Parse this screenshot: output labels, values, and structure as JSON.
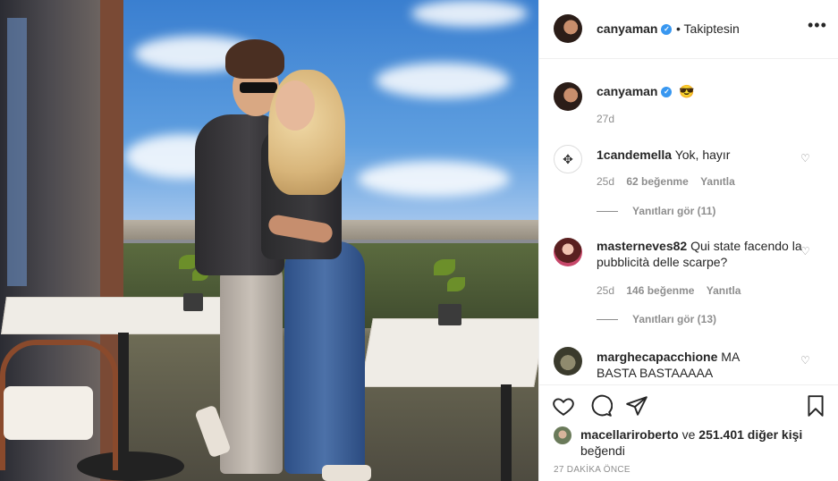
{
  "header": {
    "username": "canyaman",
    "follow_status": "• Takiptesin",
    "more_icon": "more-options-icon"
  },
  "caption": {
    "username": "canyaman",
    "emoji": "😎",
    "time": "27d"
  },
  "comments": [
    {
      "username": "1candemella",
      "text": "Yok, hayır",
      "time": "25d",
      "likes": "62 beğenme",
      "reply_label": "Yanıtla",
      "view_replies": "Yanıtları gör (11)"
    },
    {
      "username": "masterneves82",
      "text": "Qui state facendo la pubblicità delle scarpe?",
      "time": "25d",
      "likes": "146 beğenme",
      "reply_label": "Yanıtla",
      "view_replies": "Yanıtları gör (13)"
    },
    {
      "username": "marghecapacchione",
      "text": "MA BASTA BASTAAAAA"
    }
  ],
  "actions": {
    "icons": [
      "heart-icon",
      "comment-icon",
      "share-icon",
      "bookmark-icon"
    ]
  },
  "likes": {
    "user": "macellariroberto",
    "connector": "ve",
    "count": "251.401 diğer kişi",
    "suffix": "beğendi"
  },
  "timestamp": "27 DAKİKA ÖNCE"
}
